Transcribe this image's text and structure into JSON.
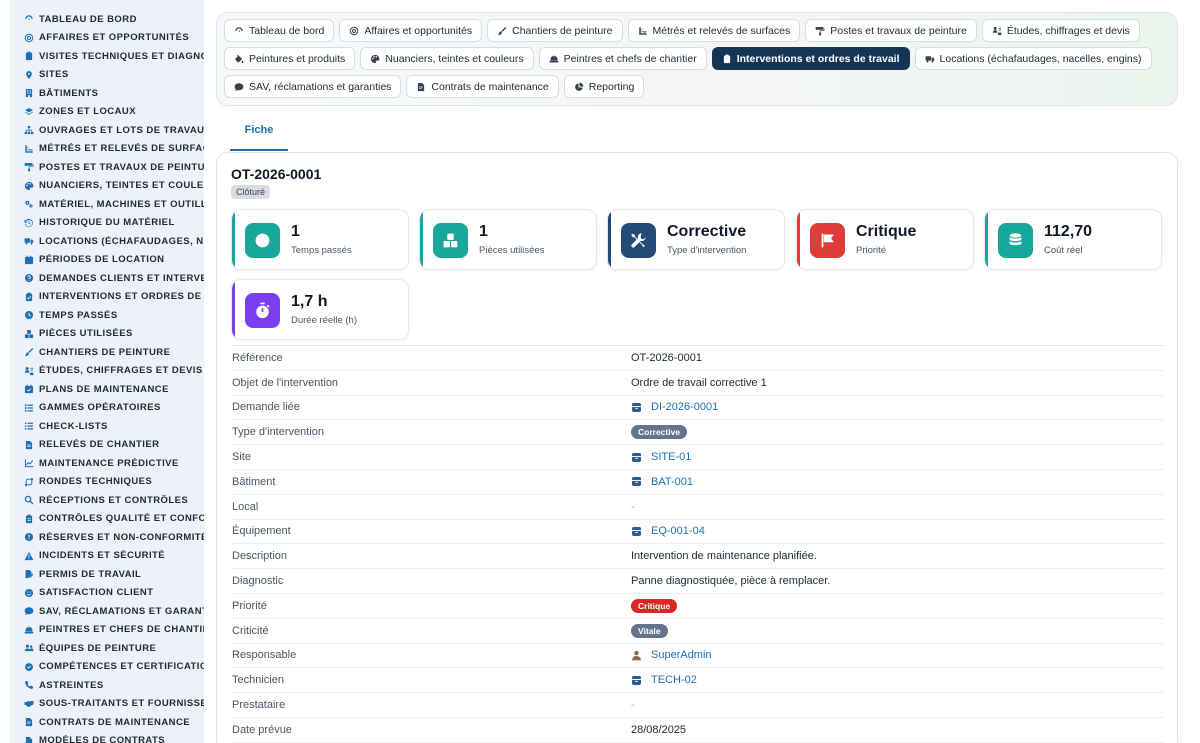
{
  "sidebar": {
    "items": [
      {
        "label": "TABLEAU DE BORD",
        "icon": "dashboard-icon"
      },
      {
        "label": "AFFAIRES ET OPPORTUNITÉS",
        "icon": "target-icon"
      },
      {
        "label": "VISITES TECHNIQUES ET DIAGNOSTICS",
        "icon": "clipboard-icon"
      },
      {
        "label": "SITES",
        "icon": "map-pin-icon"
      },
      {
        "label": "BÂTIMENTS",
        "icon": "building-icon"
      },
      {
        "label": "ZONES ET LOCAUX",
        "icon": "layers-icon"
      },
      {
        "label": "OUVRAGES ET LOTS DE TRAVAUX",
        "icon": "hierarchy-icon"
      },
      {
        "label": "MÉTRÉS ET RELEVÉS DE SURFACES",
        "icon": "ruler-icon"
      },
      {
        "label": "POSTES ET TRAVAUX DE PEINTURE",
        "icon": "paint-roller-icon"
      },
      {
        "label": "NUANCIERS, TEINTES ET COULEURS",
        "icon": "palette-icon"
      },
      {
        "label": "MATÉRIEL, MACHINES ET OUTILLAGES",
        "icon": "gears-icon"
      },
      {
        "label": "HISTORIQUE DU MATÉRIEL",
        "icon": "history-icon"
      },
      {
        "label": "LOCATIONS (ÉCHAFAUDAGES, NACELLES, ENGINS)",
        "icon": "truck-icon"
      },
      {
        "label": "PÉRIODES DE LOCATION",
        "icon": "calendar-icon"
      },
      {
        "label": "DEMANDES CLIENTS ET INTERVENTIONS",
        "icon": "question-icon"
      },
      {
        "label": "INTERVENTIONS ET ORDRES DE TRAVAIL",
        "icon": "clipboard-check-icon"
      },
      {
        "label": "TEMPS PASSÉS",
        "icon": "clock-icon"
      },
      {
        "label": "PIÈCES UTILISÉES",
        "icon": "boxes-icon"
      },
      {
        "label": "CHANTIERS DE PEINTURE",
        "icon": "paint-brush-icon"
      },
      {
        "label": "ÉTUDES, CHIFFRAGES ET DEVIS",
        "icon": "calculator-icon"
      },
      {
        "label": "PLANS DE MAINTENANCE",
        "icon": "calendar-check-icon"
      },
      {
        "label": "GAMMES OPÉRATOIRES",
        "icon": "list-ordered-icon"
      },
      {
        "label": "CHECK-LISTS",
        "icon": "list-check-icon"
      },
      {
        "label": "RELEVÉS DE CHANTIER",
        "icon": "file-lines-icon"
      },
      {
        "label": "MAINTENANCE PRÉDICTIVE",
        "icon": "chart-line-icon"
      },
      {
        "label": "RONDES TECHNIQUES",
        "icon": "route-icon"
      },
      {
        "label": "RÉCEPTIONS ET CONTRÔLES",
        "icon": "search-icon"
      },
      {
        "label": "CONTRÔLES QUALITÉ ET CONFORMITÉ",
        "icon": "clipboard-list-icon"
      },
      {
        "label": "RÉSERVES ET NON-CONFORMITÉS",
        "icon": "exclamation-circle-icon"
      },
      {
        "label": "INCIDENTS ET SÉCURITÉ",
        "icon": "warning-triangle-icon"
      },
      {
        "label": "PERMIS DE TRAVAIL",
        "icon": "file-signature-icon"
      },
      {
        "label": "SATISFACTION CLIENT",
        "icon": "smile-icon"
      },
      {
        "label": "SAV, RÉCLAMATIONS ET GARANTIES",
        "icon": "comment-icon"
      },
      {
        "label": "PEINTRES ET CHEFS DE CHANTIER",
        "icon": "hard-hat-icon"
      },
      {
        "label": "ÉQUIPES DE PEINTURE",
        "icon": "users-icon"
      },
      {
        "label": "COMPÉTENCES ET CERTIFICATIONS",
        "icon": "certificate-icon"
      },
      {
        "label": "ASTREINTES",
        "icon": "phone-icon"
      },
      {
        "label": "SOUS-TRAITANTS ET FOURNISSEURS",
        "icon": "handshake-icon"
      },
      {
        "label": "CONTRATS DE MAINTENANCE",
        "icon": "file-contract-icon"
      },
      {
        "label": "MODÈLES DE CONTRATS",
        "icon": "file-icon"
      }
    ]
  },
  "nav": {
    "tabs": [
      {
        "label": "Tableau de bord",
        "icon": "dashboard-icon",
        "active": false
      },
      {
        "label": "Affaires et opportunités",
        "icon": "target-icon",
        "active": false
      },
      {
        "label": "Chantiers de peinture",
        "icon": "paint-brush-icon",
        "active": false
      },
      {
        "label": "Métrés et relevés de surfaces",
        "icon": "ruler-icon",
        "active": false
      },
      {
        "label": "Postes et travaux de peinture",
        "icon": "paint-roller-icon",
        "active": false
      },
      {
        "label": "Études, chiffrages et devis",
        "icon": "calculator-icon",
        "active": false
      },
      {
        "label": "Peintures et produits",
        "icon": "fill-drip-icon",
        "active": false
      },
      {
        "label": "Nuanciers, teintes et couleurs",
        "icon": "palette-icon",
        "active": false
      },
      {
        "label": "Peintres et chefs de chantier",
        "icon": "hard-hat-icon",
        "active": false
      },
      {
        "label": "Interventions et ordres de travail",
        "icon": "clipboard-check-icon",
        "active": true
      },
      {
        "label": "Locations (échafaudages, nacelles, engins)",
        "icon": "truck-icon",
        "active": false
      },
      {
        "label": "SAV, réclamations et garanties",
        "icon": "comment-icon",
        "active": false
      },
      {
        "label": "Contrats de maintenance",
        "icon": "file-contract-icon",
        "active": false
      },
      {
        "label": "Reporting",
        "icon": "pie-chart-icon",
        "active": false
      }
    ]
  },
  "subtab": {
    "label": "Fiche"
  },
  "record": {
    "title": "OT-2026-0001",
    "status": "Clôturé"
  },
  "stats": [
    {
      "value": "1",
      "label": "Temps passés",
      "icon": "clock-icon",
      "color": "#1aa79b"
    },
    {
      "value": "1",
      "label": "Pièces utilisées",
      "icon": "boxes-icon",
      "color": "#1aa79b"
    },
    {
      "value": "Corrective",
      "label": "Type d'intervention",
      "icon": "tools-icon",
      "color": "#244a78"
    },
    {
      "value": "Critique",
      "label": "Priorité",
      "icon": "flag-icon",
      "color": "#e03b3b"
    },
    {
      "value": "112,70",
      "label": "Coût réel",
      "icon": "coins-icon",
      "color": "#1aa79b"
    },
    {
      "value": "1,7 h",
      "label": "Durée réelle (h)",
      "icon": "stopwatch-icon",
      "color": "#7a3ff0"
    }
  ],
  "details": [
    {
      "label": "Référence",
      "value": "OT-2026-0001",
      "kind": "text"
    },
    {
      "label": "Objet de l'intervention",
      "value": "Ordre de travail corrective 1",
      "kind": "text"
    },
    {
      "label": "Demande liée",
      "value": "DI-2026-0001",
      "kind": "link"
    },
    {
      "label": "Type d'intervention",
      "value": "Corrective",
      "kind": "pill",
      "color": "#64748b"
    },
    {
      "label": "Site",
      "value": "SITE-01",
      "kind": "link"
    },
    {
      "label": "Bâtiment",
      "value": "BAT-001",
      "kind": "link"
    },
    {
      "label": "Local",
      "value": "-",
      "kind": "dash"
    },
    {
      "label": "Équipement",
      "value": "EQ-001-04",
      "kind": "link"
    },
    {
      "label": "Description",
      "value": "Intervention de maintenance planifiée.",
      "kind": "text"
    },
    {
      "label": "Diagnostic",
      "value": "Panne diagnostiquée, pièce à remplacer.",
      "kind": "text"
    },
    {
      "label": "Priorité",
      "value": "Critique",
      "kind": "pill",
      "color": "#dc2626"
    },
    {
      "label": "Criticité",
      "value": "Vitale",
      "kind": "pill",
      "color": "#64748b"
    },
    {
      "label": "Responsable",
      "value": "SuperAdmin",
      "kind": "user"
    },
    {
      "label": "Technicien",
      "value": "TECH-02",
      "kind": "link"
    },
    {
      "label": "Prestataire",
      "value": "-",
      "kind": "dash"
    },
    {
      "label": "Date prévue",
      "value": "28/08/2025",
      "kind": "text"
    }
  ],
  "colors": {
    "accent": "#1d6fb8",
    "active_tab": "#163556",
    "teal": "#1aa79b",
    "danger": "#dc2626"
  }
}
